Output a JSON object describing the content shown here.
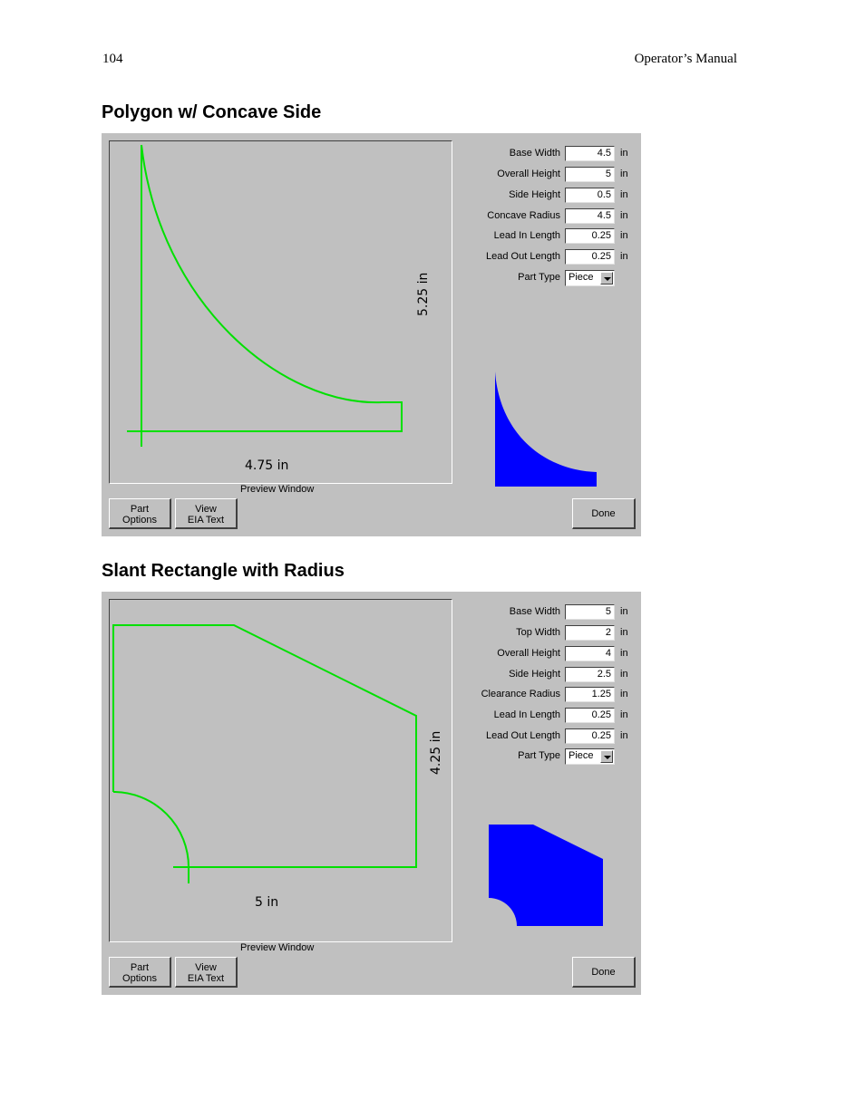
{
  "header": {
    "page_number": "104",
    "manual_title": "Operator’s Manual"
  },
  "sections": [
    {
      "title": "Polygon w/ Concave Side",
      "preview": {
        "width_label": "4.75 in",
        "height_label": "5.25 in",
        "window_label": "Preview Window"
      },
      "fields": [
        {
          "label": "Base Width",
          "value": "4.5",
          "unit": "in"
        },
        {
          "label": "Overall Height",
          "value": "5",
          "unit": "in"
        },
        {
          "label": "Side Height",
          "value": "0.5",
          "unit": "in"
        },
        {
          "label": "Concave Radius",
          "value": "4.5",
          "unit": "in"
        },
        {
          "label": "Lead In Length",
          "value": "0.25",
          "unit": "in"
        },
        {
          "label": "Lead Out Length",
          "value": "0.25",
          "unit": "in"
        }
      ],
      "part_type": {
        "label": "Part Type",
        "value": "Piece"
      },
      "buttons": {
        "part_options": [
          "Part",
          "Options"
        ],
        "view_eia": [
          "View",
          "EIA Text"
        ],
        "done": "Done"
      }
    },
    {
      "title": "Slant Rectangle with Radius",
      "preview": {
        "width_label": "5 in",
        "height_label": "4.25 in",
        "window_label": "Preview Window"
      },
      "fields": [
        {
          "label": "Base Width",
          "value": "5",
          "unit": "in"
        },
        {
          "label": "Top Width",
          "value": "2",
          "unit": "in"
        },
        {
          "label": "Overall Height",
          "value": "4",
          "unit": "in"
        },
        {
          "label": "Side Height",
          "value": "2.5",
          "unit": "in"
        },
        {
          "label": "Clearance Radius",
          "value": "1.25",
          "unit": "in"
        },
        {
          "label": "Lead In Length",
          "value": "0.25",
          "unit": "in"
        },
        {
          "label": "Lead Out Length",
          "value": "0.25",
          "unit": "in"
        }
      ],
      "part_type": {
        "label": "Part Type",
        "value": "Piece"
      },
      "buttons": {
        "part_options": [
          "Part",
          "Options"
        ],
        "view_eia": [
          "View",
          "EIA Text"
        ],
        "done": "Done"
      }
    }
  ],
  "colors": {
    "path": "#00e000",
    "shape_fill": "#0000ff",
    "dialog_bg": "#c0c0c0"
  }
}
